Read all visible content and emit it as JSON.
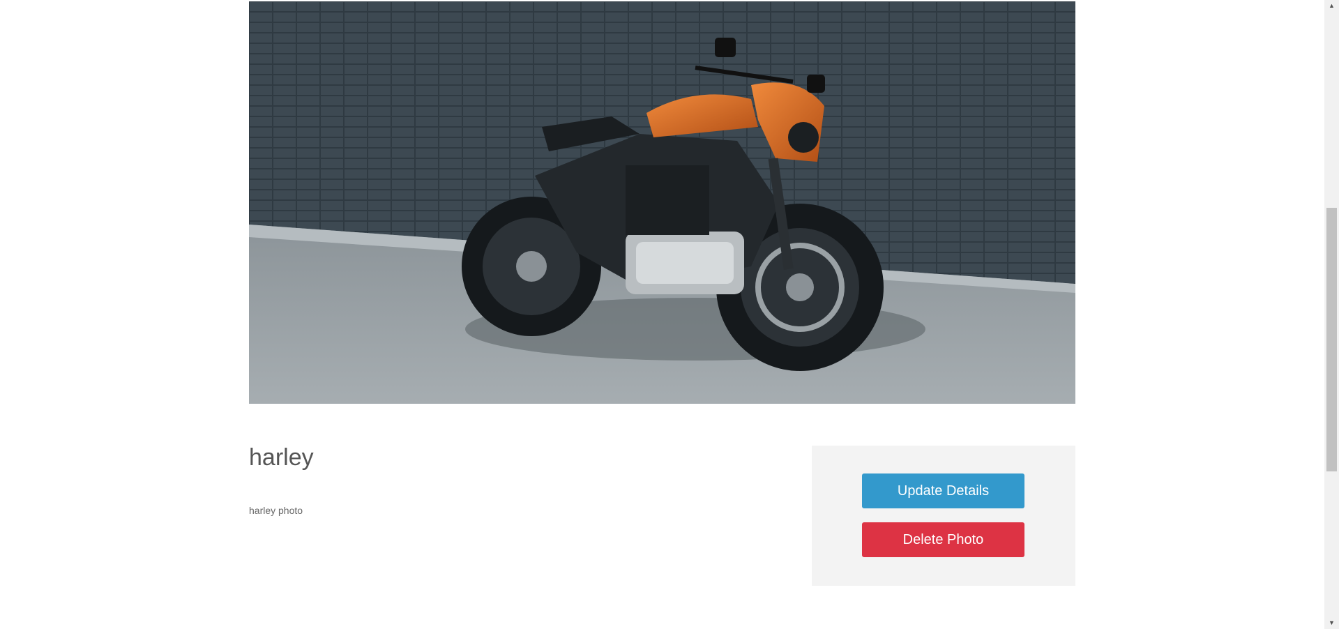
{
  "photo": {
    "name": "harley",
    "description": "harley photo"
  },
  "actions": {
    "update_label": "Update Details",
    "delete_label": "Delete Photo"
  },
  "colors": {
    "update_button": "#3399cc",
    "delete_button": "#dd3344",
    "panel_background": "#f3f3f3"
  }
}
